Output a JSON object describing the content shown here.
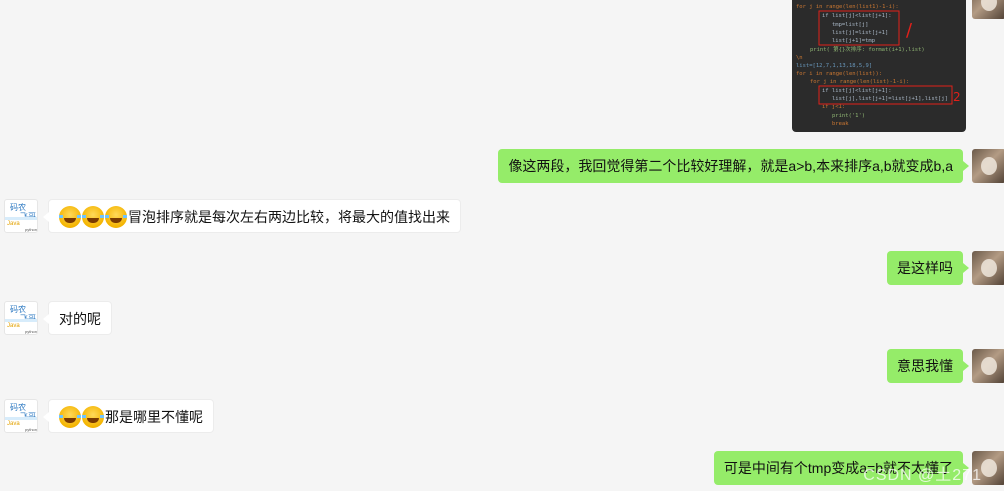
{
  "messages": [
    {
      "sender": "me",
      "text": "像这两段，我回觉得第二个比较好理解，就是a>b,本来排序a,b就变成b,a"
    },
    {
      "sender": "other",
      "emoji_count": 3,
      "text": "冒泡排序就是每次左右两边比较，将最大的值找出来"
    },
    {
      "sender": "me",
      "text": "是这样吗"
    },
    {
      "sender": "other",
      "text": "对的呢"
    },
    {
      "sender": "me",
      "text": "意思我懂"
    },
    {
      "sender": "other",
      "emoji_count": 2,
      "text": "那是哪里不懂呢"
    },
    {
      "sender": "me",
      "text": "可是中间有个tmp变成a=b就不太懂了"
    }
  ],
  "other_avatar": {
    "line1": "码农",
    "line2": "飞哥",
    "line3": "Java",
    "line4": "python"
  },
  "code_image": {
    "lines": [
      "for j in range(len(list1)-1-i):",
      "if list[j]<list[j+1]:",
      "tmp=list[j]",
      "list[j]=list[j+1]",
      "list[j+1]=tmp",
      "print( 第{}次排序: format(i+1),list)",
      "\\n",
      "list=[12,7,1,13,18,5,9]",
      "for i in range(len(list)):",
      "for j in range(len(list)-1-i):",
      "if list[j]<list[j+1]:",
      "list[j],list[j+1]=list[j+1],list[j]",
      "if j<1:",
      "print('1')",
      "break"
    ],
    "annotation1": "/",
    "annotation2": "2"
  },
  "watermark": "CSDN @土271"
}
